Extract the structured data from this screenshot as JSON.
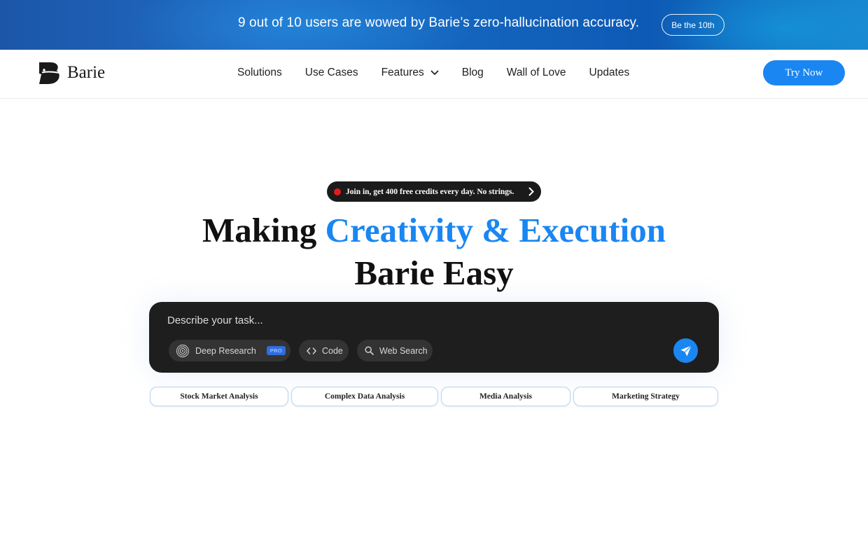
{
  "banner": {
    "message": "9 out of 10 users are wowed by Barie’s zero-hallucination accuracy.",
    "cta_label": "Be the 10th"
  },
  "nav": {
    "logo_text": "Barie",
    "links": [
      "Solutions",
      "Use Cases",
      "Features",
      "Blog",
      "Wall of Love",
      "Updates"
    ],
    "try_now_label": "Try Now"
  },
  "hero": {
    "pill_text": "Join in, get 400 free credits every day. No strings.",
    "headline_part1": "Making ",
    "headline_accent": "Creativity & Execution",
    "headline_part2": "Barie Easy"
  },
  "task_box": {
    "placeholder": "Describe your task...",
    "chips": {
      "deep_research": "Deep Research",
      "pro_badge": "PRO",
      "code": "Code",
      "web_search": "Web Search"
    }
  },
  "suggestions": [
    "Stock Market Analysis",
    "Complex Data Analysis",
    "Media Analysis",
    "Marketing Strategy"
  ],
  "colors": {
    "accent": "#1a86f2",
    "banner": "#1c5fb5",
    "dark_panel": "#1e1e1e",
    "live_dot": "#e41b1b"
  },
  "icons": {
    "logo": "barie-logo-icon",
    "features_dropdown": "chevron-down-icon",
    "pill_arrow": "chevron-right-icon",
    "deep_research": "concentric-circles-icon",
    "code": "code-brackets-icon",
    "web_search": "search-icon",
    "send": "paper-plane-icon"
  }
}
